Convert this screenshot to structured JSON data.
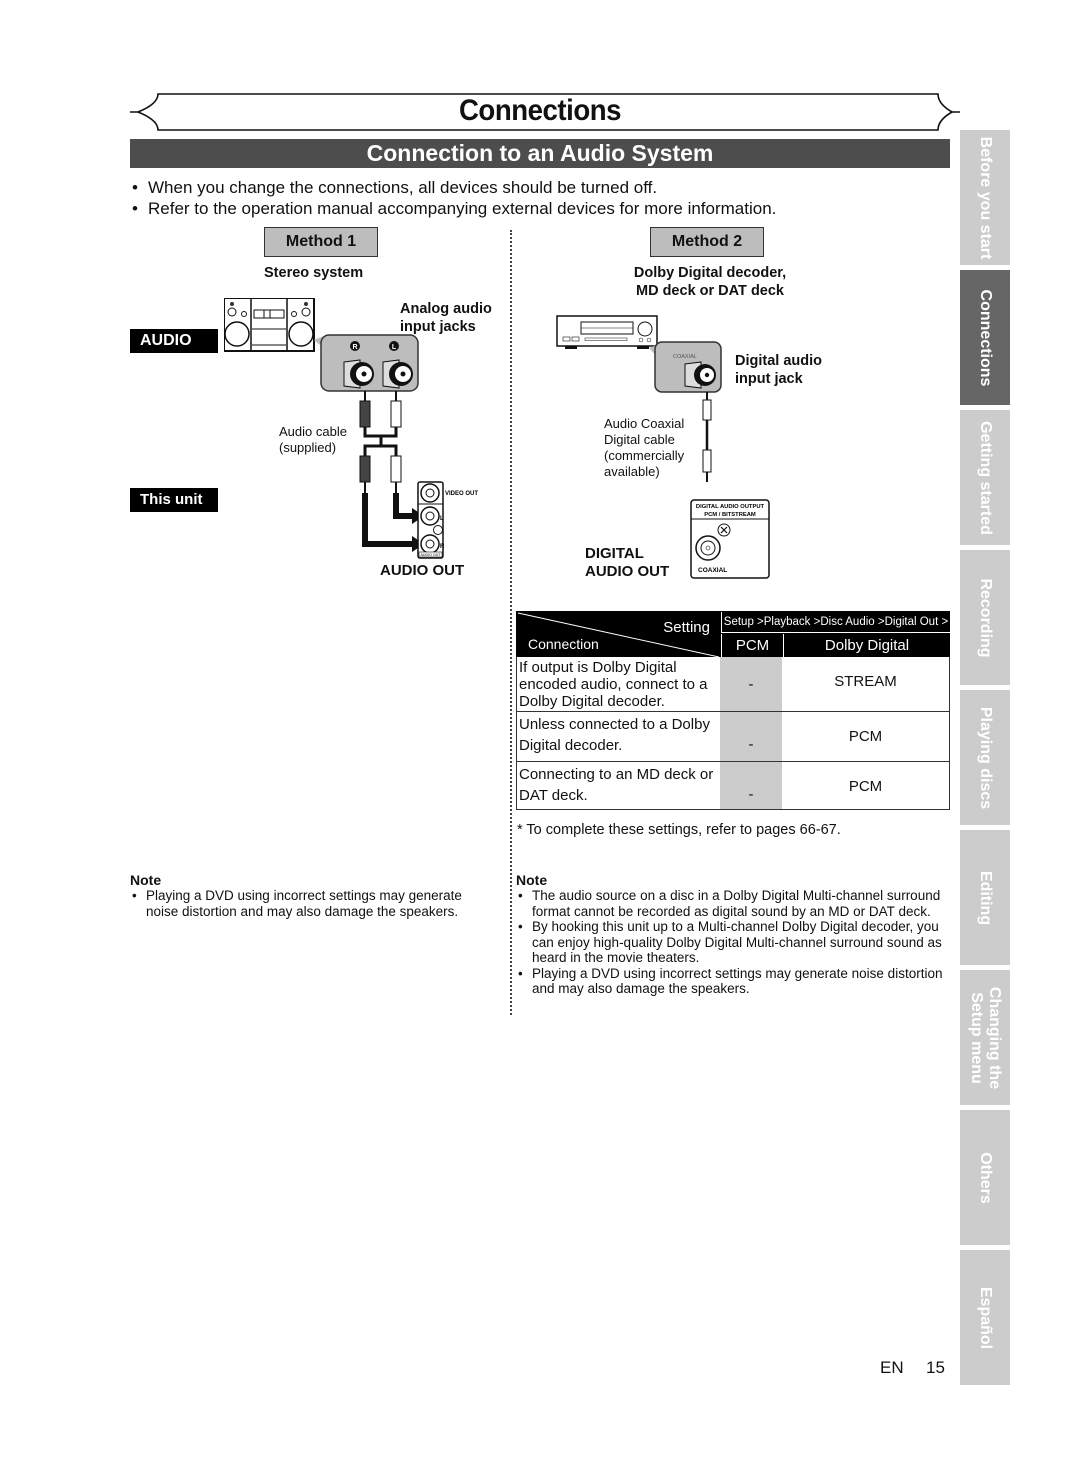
{
  "page": {
    "banner_title": "Connections",
    "section_title": "Connection to an Audio System",
    "bullets": [
      "When you change the connections, all devices should be turned off.",
      "Refer to the operation manual accompanying external devices for more information."
    ],
    "language": "EN",
    "page_number": "15"
  },
  "method1": {
    "label": "Method 1",
    "device": "Stereo system",
    "device_tag": "AUDIO",
    "jack_label_line1": "Analog audio",
    "jack_label_line2": "input jacks",
    "jack_r": "R",
    "jack_l": "L",
    "cable_line1": "Audio cable",
    "cable_line2": "(supplied)",
    "unit_tag": "This unit",
    "panel_video_out": "VIDEO OUT",
    "panel_l": "L",
    "panel_r": "R",
    "panel_audio_out": "AUDIO OUT",
    "output_label": "AUDIO OUT"
  },
  "method2": {
    "label": "Method 2",
    "device_line1": "Dolby Digital decoder,",
    "device_line2": "MD deck or DAT deck",
    "coaxial_tag": "COAXIAL",
    "jack_label_line1": "Digital audio",
    "jack_label_line2": "input jack",
    "cable_lines": [
      "Audio Coaxial",
      "Digital cable",
      "(commercially",
      "available)"
    ],
    "panel_title_line1": "DIGITAL AUDIO OUTPUT",
    "panel_title_line2": "PCM / BITSTREAM",
    "panel_coaxial": "COAXIAL",
    "output_line1": "DIGITAL",
    "output_line2": "AUDIO OUT"
  },
  "table": {
    "header_setting": "Setting",
    "header_connection": "Connection",
    "menu_path": "Setup >Playback >Disc Audio >Digital Out >",
    "col_pcm": "PCM",
    "col_dolby": "Dolby Digital",
    "rows": [
      {
        "connection": "If output is Dolby Digital encoded audio, connect to a Dolby Digital decoder.",
        "pcm": "-",
        "dolby": "STREAM"
      },
      {
        "connection": "Unless connected to a Dolby Digital decoder.",
        "pcm": "-",
        "dolby": "PCM"
      },
      {
        "connection": "Connecting to an MD deck or DAT deck.",
        "pcm": "-",
        "dolby": "PCM"
      }
    ],
    "footnote": "* To complete these settings, refer to pages 66-67."
  },
  "notes": {
    "left": {
      "title": "Note",
      "items": [
        "Playing a DVD using incorrect settings may generate noise distortion and may also damage the speakers."
      ]
    },
    "right": {
      "title": "Note",
      "items": [
        "The audio source on a disc in a Dolby Digital Multi-channel surround format cannot be recorded as digital sound by an MD or DAT deck.",
        "By hooking this unit up to a Multi-channel Dolby Digital decoder, you can enjoy high-quality Dolby Digital Multi-channel surround sound as heard in the movie theaters.",
        "Playing a DVD using incorrect settings may generate noise distortion and may also damage the speakers."
      ]
    }
  },
  "side_tabs": [
    {
      "label": "Before you start",
      "active": false
    },
    {
      "label": "Connections",
      "active": true
    },
    {
      "label": "Getting started",
      "active": false
    },
    {
      "label": "Recording",
      "active": false
    },
    {
      "label": "Playing discs",
      "active": false
    },
    {
      "label": "Editing",
      "active": false
    },
    {
      "label": "Changing the\nSetup menu",
      "active": false
    },
    {
      "label": "Others",
      "active": false
    },
    {
      "label": "Español",
      "active": false
    }
  ],
  "colors": {
    "section_bar": "#4d4d4d",
    "method_box": "#bdbdbd",
    "tab_inactive": "#cccccc",
    "tab_active": "#666666",
    "pcm_column": "#cccccc"
  }
}
